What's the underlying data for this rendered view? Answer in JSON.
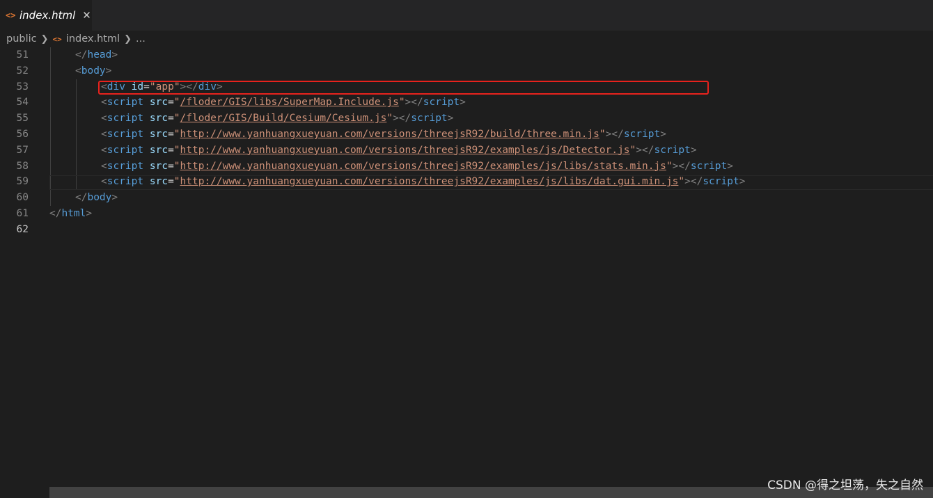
{
  "tab": {
    "icon": "<>",
    "icon_name": "html-file-icon",
    "label": "index.html",
    "close": "✕"
  },
  "breadcrumb": {
    "folder": "public",
    "file": "index.html",
    "ellipsis": "..."
  },
  "lines": [
    {
      "number": "51",
      "pre": "</",
      "tag": "head",
      "post": ">"
    },
    {
      "number": "52",
      "pre": "<",
      "tag": "body",
      "post": ">"
    },
    {
      "number": "53",
      "pre": "<",
      "tag": "div",
      "attr": "id",
      "value": "\"app\"",
      "close_pre": "></",
      "close_tag": "div",
      "close_post": ">"
    },
    {
      "number": "54",
      "pre": "<",
      "tag": "script",
      "attr": "src",
      "value": "\"/floder/GIS/libs/SuperMap.Include.js\"",
      "close_pre": "></",
      "close_tag": "script",
      "close_post": ">"
    },
    {
      "number": "55",
      "pre": "<",
      "tag": "script",
      "attr": "src",
      "value": "\"/floder/GIS/Build/Cesium/Cesium.js\"",
      "close_pre": "></",
      "close_tag": "script",
      "close_post": ">"
    },
    {
      "number": "56",
      "pre": "<",
      "tag": "script",
      "attr": "src",
      "value": "\"http://www.yanhuangxueyuan.com/versions/threejsR92/build/three.min.js\"",
      "close_pre": "></",
      "close_tag": "script",
      "close_post": ">"
    },
    {
      "number": "57",
      "pre": "<",
      "tag": "script",
      "attr": "src",
      "value": "\"http://www.yanhuangxueyuan.com/versions/threejsR92/examples/js/Detector.js\"",
      "close_pre": "></",
      "close_tag": "script",
      "close_post": ">"
    },
    {
      "number": "58",
      "pre": "<",
      "tag": "script",
      "attr": "src",
      "value": "\"http://www.yanhuangxueyuan.com/versions/threejsR92/examples/js/libs/stats.min.js\"",
      "close_pre": "></",
      "close_tag": "script",
      "close_post": ">"
    },
    {
      "number": "59",
      "pre": "<",
      "tag": "script",
      "attr": "src",
      "value": "\"http://www.yanhuangxueyuan.com/versions/threejsR92/examples/js/libs/dat.gui.min.js\"",
      "close_pre": "></",
      "close_tag": "script",
      "close_post": ">"
    },
    {
      "number": "60",
      "pre": "</",
      "tag": "body",
      "post": ">"
    },
    {
      "number": "61",
      "pre": "</",
      "tag": "html",
      "post": ">"
    },
    {
      "number": "62"
    }
  ],
  "highlighted_line": "56",
  "watermark": "CSDN @得之坦荡，失之自然",
  "colors": {
    "background": "#1e1e1e",
    "tag": "#569cd6",
    "attribute": "#9cdcfe",
    "string": "#ce9178",
    "highlight_box": "#e8221d",
    "file_icon": "#e37933"
  }
}
